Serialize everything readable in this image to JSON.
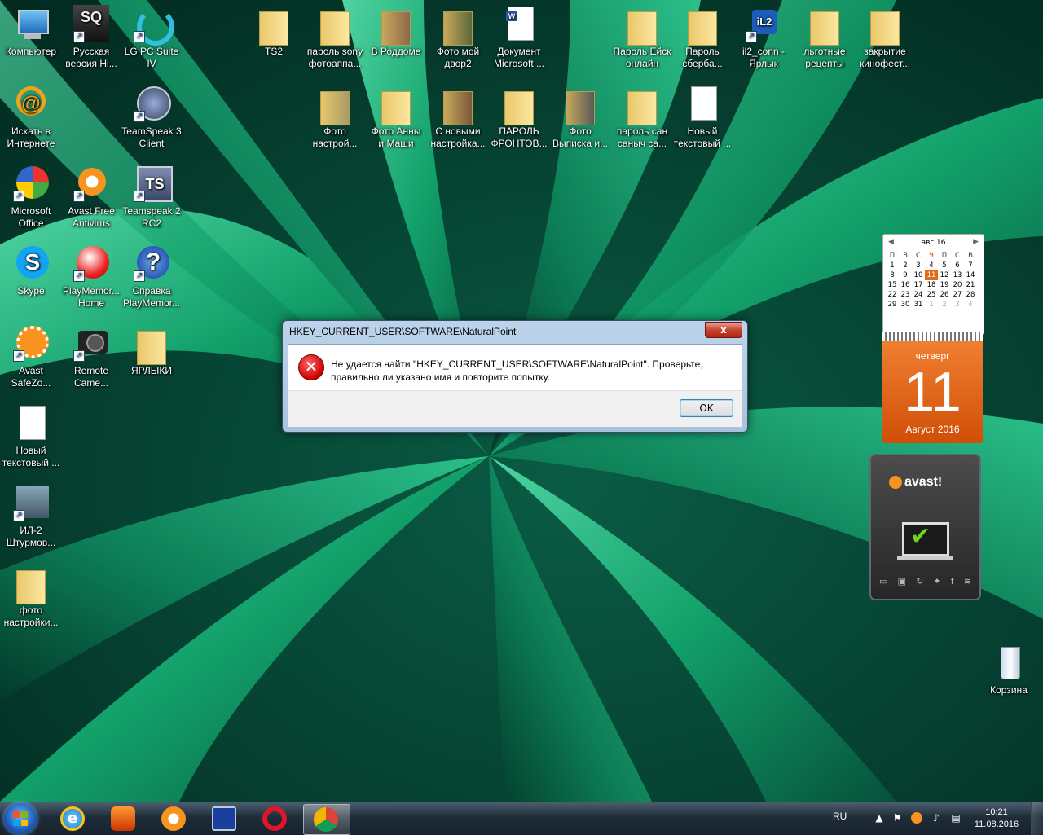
{
  "desktop_icons": [
    {
      "label": "Компьютер",
      "icon": "computer-icon"
    },
    {
      "label": "Русская\nверсия Hi...",
      "icon": "game-icon"
    },
    {
      "label": "LG PC Suite\nIV",
      "icon": "sync-icon"
    },
    {
      "label": "Искать в\nИнтернете",
      "icon": "mail-search-icon"
    },
    {
      "label": "TeamSpeak 3\nClient",
      "icon": "teamspeak-icon"
    },
    {
      "label": "Microsoft\nOffice",
      "icon": "office-icon"
    },
    {
      "label": "Avast Free\nAntivirus",
      "icon": "avast-icon"
    },
    {
      "label": "Teamspeak 2\nRC2",
      "icon": "ts2-icon"
    },
    {
      "label": "Skype",
      "icon": "skype-icon"
    },
    {
      "label": "PlayMemor...\nHome",
      "icon": "playmemories-icon"
    },
    {
      "label": "Справка\nPlayMemor...",
      "icon": "help-icon"
    },
    {
      "label": "Avast\nSafeZo...",
      "icon": "safezone-icon"
    },
    {
      "label": "Remote\nCame...",
      "icon": "camera-icon"
    },
    {
      "label": "ЯРЛЫКИ",
      "icon": "folder-icon"
    },
    {
      "label": "Новый\nтекстовый ...",
      "icon": "text-file-icon"
    },
    {
      "label": "ИЛ-2\nШтурмов...",
      "icon": "il2-icon"
    },
    {
      "label": "фото\nнастройки...",
      "icon": "folder-icon"
    },
    {
      "label": "TS2",
      "icon": "folder-icon"
    },
    {
      "label": "пароль sony\nфотоаппа...",
      "icon": "folder-icon"
    },
    {
      "label": "В Роддоме",
      "icon": "folder-icon"
    },
    {
      "label": "Фото мой\nдвор2",
      "icon": "folder-icon"
    },
    {
      "label": "Документ\nMicrosoft ...",
      "icon": "word-doc-icon"
    },
    {
      "label": "Пароль Ейск\nонлайн",
      "icon": "folder-icon"
    },
    {
      "label": "Пароль\nсберба...",
      "icon": "folder-icon"
    },
    {
      "label": "il2_conn -\nЯрлык",
      "icon": "network-icon"
    },
    {
      "label": "льготные\nрецепты",
      "icon": "folder-icon"
    },
    {
      "label": "закрытие\nкинофест...",
      "icon": "folder-icon"
    },
    {
      "label": "Фото\nнастрой...",
      "icon": "folder-icon"
    },
    {
      "label": "Фото Анны\nи Маши",
      "icon": "folder-icon"
    },
    {
      "label": "С новыми\nнастройка...",
      "icon": "folder-icon"
    },
    {
      "label": "ПАРОЛЬ\nФРОНТОВ...",
      "icon": "folder-icon"
    },
    {
      "label": "Фото\nВыписка и...",
      "icon": "folder-icon"
    },
    {
      "label": "пароль сан\nсаныч са...",
      "icon": "folder-icon"
    },
    {
      "label": "Новый\nтекстовый ...",
      "icon": "text-file-icon"
    },
    {
      "label": "Корзина",
      "icon": "recycle-bin-icon"
    }
  ],
  "dialog": {
    "title": "HKEY_CURRENT_USER\\SOFTWARE\\NaturalPoint",
    "close_label": "x",
    "message": "Не удается найти \"HKEY_CURRENT_USER\\SOFTWARE\\NaturalPoint\". Проверьте, правильно ли указано имя и повторите попытку.",
    "ok_label": "OK"
  },
  "calendar": {
    "month_title": "авг 16",
    "prev": "◀",
    "next": "▶",
    "weekday_headers": [
      "П",
      "В",
      "С",
      "Ч",
      "П",
      "С",
      "В"
    ],
    "weeks": [
      [
        "1",
        "2",
        "3",
        "4",
        "5",
        "6",
        "7"
      ],
      [
        "8",
        "9",
        "10",
        "11",
        "12",
        "13",
        "14"
      ],
      [
        "15",
        "16",
        "17",
        "18",
        "19",
        "20",
        "21"
      ],
      [
        "22",
        "23",
        "24",
        "25",
        "26",
        "27",
        "28"
      ],
      [
        "29",
        "30",
        "31",
        "1",
        "2",
        "3",
        "4"
      ]
    ],
    "today": "11",
    "weekday": "четверг",
    "day": "11",
    "month_year": "Август 2016"
  },
  "avast_gadget": {
    "logo": "avast!",
    "status": "protected"
  },
  "taskbar": {
    "pinned": [
      "ie-icon",
      "sprint-icon",
      "avast-icon",
      "save-icon",
      "opera-icon",
      "chrome-icon"
    ],
    "language": "RU",
    "time": "10:21",
    "date": "11.08.2016"
  },
  "colors": {
    "accent": "#e26a14",
    "error": "#cc0000"
  }
}
